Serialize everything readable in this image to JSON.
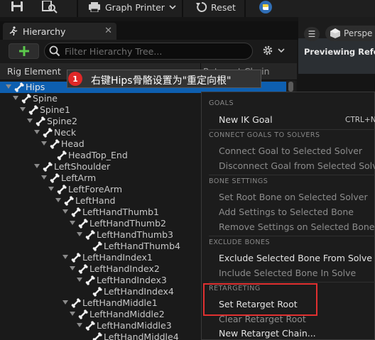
{
  "toolbar": {
    "graph_printer_label": "Graph Printer",
    "reset_label": "Reset",
    "icons": [
      "save-icon",
      "find-in-content-icon",
      "graph-printer-icon",
      "reset-icon",
      "python-icon"
    ]
  },
  "hierarchy": {
    "tab_label": "Hierarchy",
    "close_glyph": "✕",
    "add_glyph": "+",
    "search_placeholder": "Filter Hierarchy Tree...",
    "col_rig_element": "Rig Element",
    "col_retarget_chain": "Retarget Chain",
    "rows": [
      {
        "label": "Hips",
        "depth": 0,
        "arrow": true,
        "selected": true
      },
      {
        "label": "Spine",
        "depth": 1,
        "arrow": true
      },
      {
        "label": "Spine1",
        "depth": 2,
        "arrow": true
      },
      {
        "label": "Spine2",
        "depth": 3,
        "arrow": true
      },
      {
        "label": "Neck",
        "depth": 4,
        "arrow": true
      },
      {
        "label": "Head",
        "depth": 5,
        "arrow": true
      },
      {
        "label": "HeadTop_End",
        "depth": 6,
        "arrow": false
      },
      {
        "label": "LeftShoulder",
        "depth": 4,
        "arrow": true
      },
      {
        "label": "LeftArm",
        "depth": 5,
        "arrow": true
      },
      {
        "label": "LeftForeArm",
        "depth": 6,
        "arrow": true
      },
      {
        "label": "LeftHand",
        "depth": 7,
        "arrow": true
      },
      {
        "label": "LeftHandThumb1",
        "depth": 8,
        "arrow": true
      },
      {
        "label": "LeftHandThumb2",
        "depth": 9,
        "arrow": true
      },
      {
        "label": "LeftHandThumb3",
        "depth": 10,
        "arrow": true
      },
      {
        "label": "LeftHandThumb4",
        "depth": 11,
        "arrow": false
      },
      {
        "label": "LeftHandIndex1",
        "depth": 8,
        "arrow": true
      },
      {
        "label": "LeftHandIndex2",
        "depth": 9,
        "arrow": true
      },
      {
        "label": "LeftHandIndex3",
        "depth": 10,
        "arrow": true
      },
      {
        "label": "LeftHandIndex4",
        "depth": 11,
        "arrow": false
      },
      {
        "label": "LeftHandMiddle1",
        "depth": 8,
        "arrow": true
      },
      {
        "label": "LeftHandMiddle2",
        "depth": 9,
        "arrow": true
      },
      {
        "label": "LeftHandMiddle3",
        "depth": 10,
        "arrow": true
      },
      {
        "label": "LeftHandMiddle4",
        "depth": 11,
        "arrow": false
      }
    ]
  },
  "viewport": {
    "menu_glyph": "☰",
    "perspective_label": "Perspe",
    "previewing_label": "Previewing Refer"
  },
  "tooltip": {
    "badge": "1",
    "text": "右键Hips骨骼设置为\"重定向根\""
  },
  "context_menu": {
    "goals_header": "GOALS",
    "new_ik_goal": "New IK Goal",
    "new_ik_goal_shortcut": "CTRL+N",
    "connect_header": "CONNECT GOALS TO SOLVERS",
    "connect_goal": "Connect Goal to Selected Solver",
    "disconnect_goal": "Disconnect Goal from Selected Solver",
    "bone_settings_header": "BONE SETTINGS",
    "set_root_bone": "Set Root Bone on Selected Solver",
    "add_settings": "Add Settings to Selected Bone",
    "remove_settings": "Remove Settings on Selected Bone",
    "exclude_header": "EXCLUDE BONES",
    "exclude_bone": "Exclude Selected Bone From Solve",
    "include_bone": "Include Selected Bone In Solve",
    "retargeting_header": "RETARGETING",
    "set_retarget_root": "Set Retarget Root",
    "clear_retarget_root": "Clear Retarget Root",
    "new_retarget_chain": "New Retarget Chain..."
  },
  "colors": {
    "selection": "#0e5fb0",
    "add_plus": "#5cc94c",
    "highlight_box": "#e03030",
    "badge": "#e02828"
  }
}
